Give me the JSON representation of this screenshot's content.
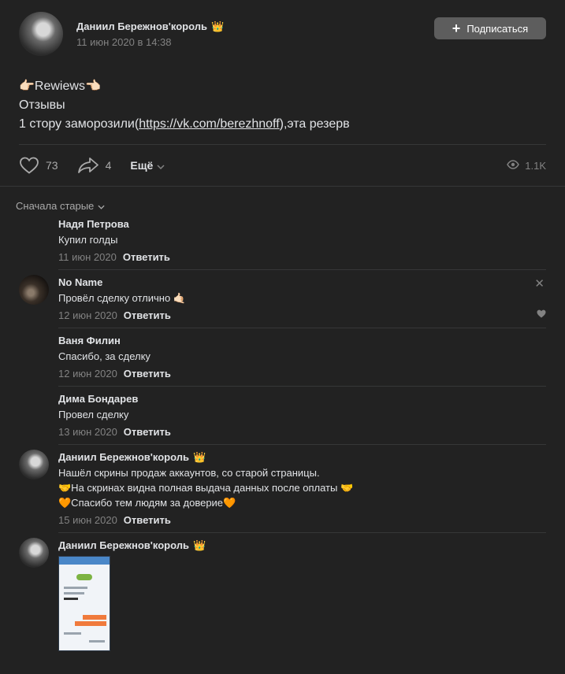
{
  "post": {
    "author": "Даниил Бережнов'король",
    "crown_emoji": "👑",
    "date": "11 июн 2020 в 14:38",
    "subscribe_label": "Подписаться",
    "text_line1": "👉🏻Rewiews👈🏻",
    "text_line2": "Отзывы",
    "text_line3_prefix": "1 стору заморозили(",
    "text_line3_link": "https://vk.com/berezhnoff",
    "text_line3_suffix": "),эта резерв",
    "likes": "73",
    "shares": "4",
    "more_label": "Ещё",
    "views": "1.1K"
  },
  "sort_label": "Сначала старые",
  "comments": [
    {
      "name": "Надя Петрова",
      "text": "Купил голды",
      "date": "11 июн 2020",
      "reply": "Ответить"
    },
    {
      "name": "No Name",
      "text": "Провёл сделку отлично 🤙🏻",
      "date": "12 июн 2020",
      "reply": "Ответить"
    },
    {
      "name": "Ваня Филин",
      "text": "Спасибо, за сделку",
      "date": "12 июн 2020",
      "reply": "Ответить"
    },
    {
      "name": "Дима Бондарев",
      "text": "Провел сделку",
      "date": "13 июн 2020",
      "reply": "Ответить"
    },
    {
      "name": "Даниил Бережнов'король",
      "crown": "👑",
      "text_line1": "Нашёл скрины продаж аккаунтов, со старой страницы.",
      "text_line2": "🤝На скринах видна полная выдача данных после оплаты 🤝",
      "text_line3": "🧡Спасибо тем людям за доверие🧡",
      "date": "15 июн 2020",
      "reply": "Ответить"
    },
    {
      "name": "Даниил Бережнов'король",
      "crown": "👑"
    }
  ]
}
